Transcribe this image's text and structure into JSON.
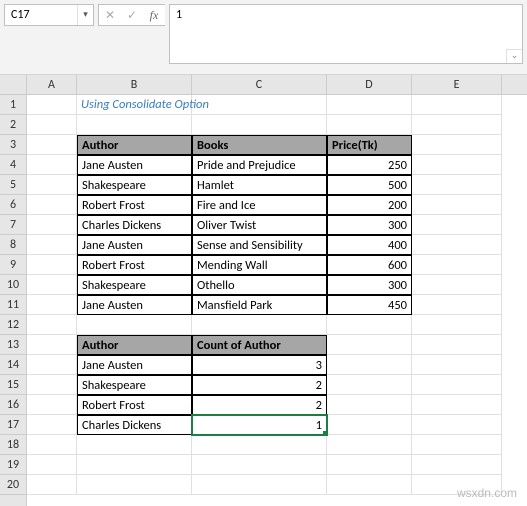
{
  "ribbon": {
    "name_box": "C17",
    "formula_value": "1",
    "fx_label": "fx"
  },
  "columns": [
    "A",
    "B",
    "C",
    "D",
    "E"
  ],
  "rows": [
    "1",
    "2",
    "3",
    "4",
    "5",
    "6",
    "7",
    "8",
    "9",
    "10",
    "11",
    "12",
    "13",
    "14",
    "15",
    "16",
    "17",
    "18",
    "19",
    "20"
  ],
  "title": "Using Consolidate Option",
  "table1": {
    "headers": {
      "author": "Author",
      "books": "Books",
      "price": "Price(Tk)"
    },
    "rows": [
      {
        "author": "Jane Austen",
        "book": "Pride and Prejudice",
        "price": "250"
      },
      {
        "author": "Shakespeare",
        "book": "Hamlet",
        "price": "500"
      },
      {
        "author": "Robert Frost",
        "book": "Fire and Ice",
        "price": "200"
      },
      {
        "author": "Charles Dickens",
        "book": "Oliver Twist",
        "price": "300"
      },
      {
        "author": "Jane Austen",
        "book": "Sense and Sensibility",
        "price": "400"
      },
      {
        "author": "Robert Frost",
        "book": "Mending Wall",
        "price": "600"
      },
      {
        "author": "Shakespeare",
        "book": "Othello",
        "price": "300"
      },
      {
        "author": "Jane Austen",
        "book": "Mansfield Park",
        "price": "450"
      }
    ]
  },
  "table2": {
    "headers": {
      "author": "Author",
      "count": "Count of Author"
    },
    "rows": [
      {
        "author": "Jane Austen",
        "count": "3"
      },
      {
        "author": "Shakespeare",
        "count": "2"
      },
      {
        "author": "Robert Frost",
        "count": "2"
      },
      {
        "author": "Charles Dickens",
        "count": "1"
      }
    ]
  },
  "watermark": "wsxdn.com",
  "icons": {
    "cancel": "✕",
    "confirm": "✓",
    "dropdown": "▾",
    "expand": "⌄"
  }
}
